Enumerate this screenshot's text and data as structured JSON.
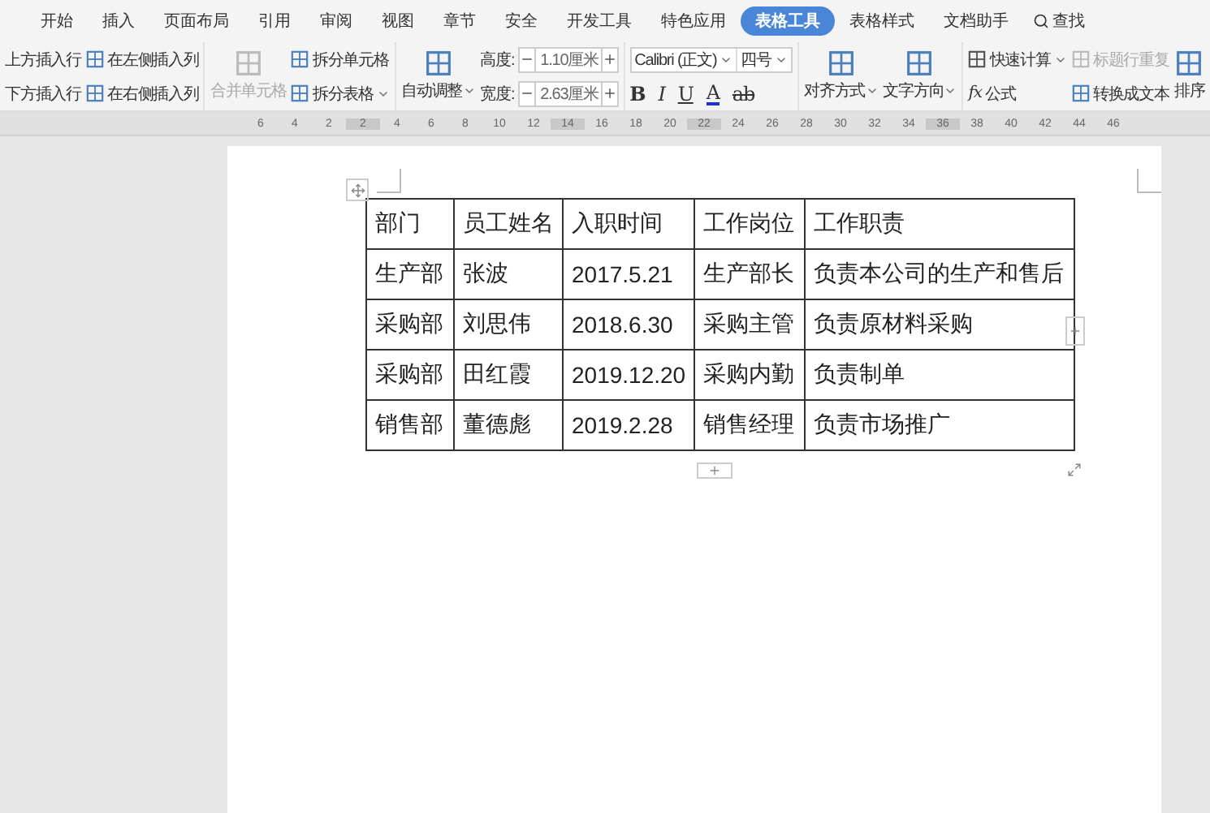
{
  "tabs": [
    {
      "label": "开始",
      "selected": false
    },
    {
      "label": "插入",
      "selected": false
    },
    {
      "label": "页面布局",
      "selected": false
    },
    {
      "label": "引用",
      "selected": false
    },
    {
      "label": "审阅",
      "selected": false
    },
    {
      "label": "视图",
      "selected": false
    },
    {
      "label": "章节",
      "selected": false
    },
    {
      "label": "安全",
      "selected": false
    },
    {
      "label": "开发工具",
      "selected": false
    },
    {
      "label": "特色应用",
      "selected": false
    },
    {
      "label": "表格工具",
      "selected": true
    },
    {
      "label": "表格样式",
      "selected": false
    },
    {
      "label": "文档助手",
      "selected": false
    }
  ],
  "search": {
    "label": "查找"
  },
  "insert": {
    "row_above": "上方插入行",
    "row_below": "下方插入行",
    "col_left": "在左侧插入列",
    "col_right": "在右侧插入列"
  },
  "merge": {
    "merge_cells": {
      "label": "合并单元格",
      "disabled": true
    },
    "split_cells": "拆分单元格",
    "split_table": "拆分表格"
  },
  "size": {
    "auto_fit": "自动调整",
    "height": {
      "label": "高度:",
      "value": "1.10厘米"
    },
    "width": {
      "label": "宽度:",
      "value": "2.63厘米"
    }
  },
  "font": {
    "family": "Calibri (正文)",
    "size": "四号",
    "bold": "B",
    "italic": "I",
    "underline": "U",
    "font_color": "A",
    "highlight": "ab"
  },
  "align": {
    "align": "对齐方式",
    "direction": "文字方向"
  },
  "data": {
    "quick_calc": "快速计算",
    "repeat_header": {
      "label": "标题行重复",
      "disabled": true
    },
    "formula_icon": "fx",
    "formula": "公式",
    "to_text": "转换成文本",
    "sort": "排序"
  },
  "ruler": [
    "6",
    "4",
    "2",
    "2",
    "4",
    "6",
    "8",
    "10",
    "12",
    "14",
    "16",
    "18",
    "20",
    "22",
    "24",
    "26",
    "28",
    "30",
    "32",
    "34",
    "36",
    "38",
    "40",
    "42",
    "44",
    "46"
  ],
  "table": {
    "columns": [
      "部门",
      "员工姓名",
      "入职时间",
      "工作岗位",
      "工作职责"
    ],
    "rows": [
      [
        "生产部",
        "张波",
        "2017.5.21",
        "生产部长",
        "负责本公司的生产和售后"
      ],
      [
        "采购部",
        "刘思伟",
        "2018.6.30",
        "采购主管",
        "负责原材料采购"
      ],
      [
        "采购部",
        "田红霞",
        "2019.12.20",
        "采购内勤",
        "负责制单"
      ],
      [
        "销售部",
        "董德彪",
        "2019.2.28",
        "销售经理",
        "负责市场推广"
      ]
    ]
  }
}
